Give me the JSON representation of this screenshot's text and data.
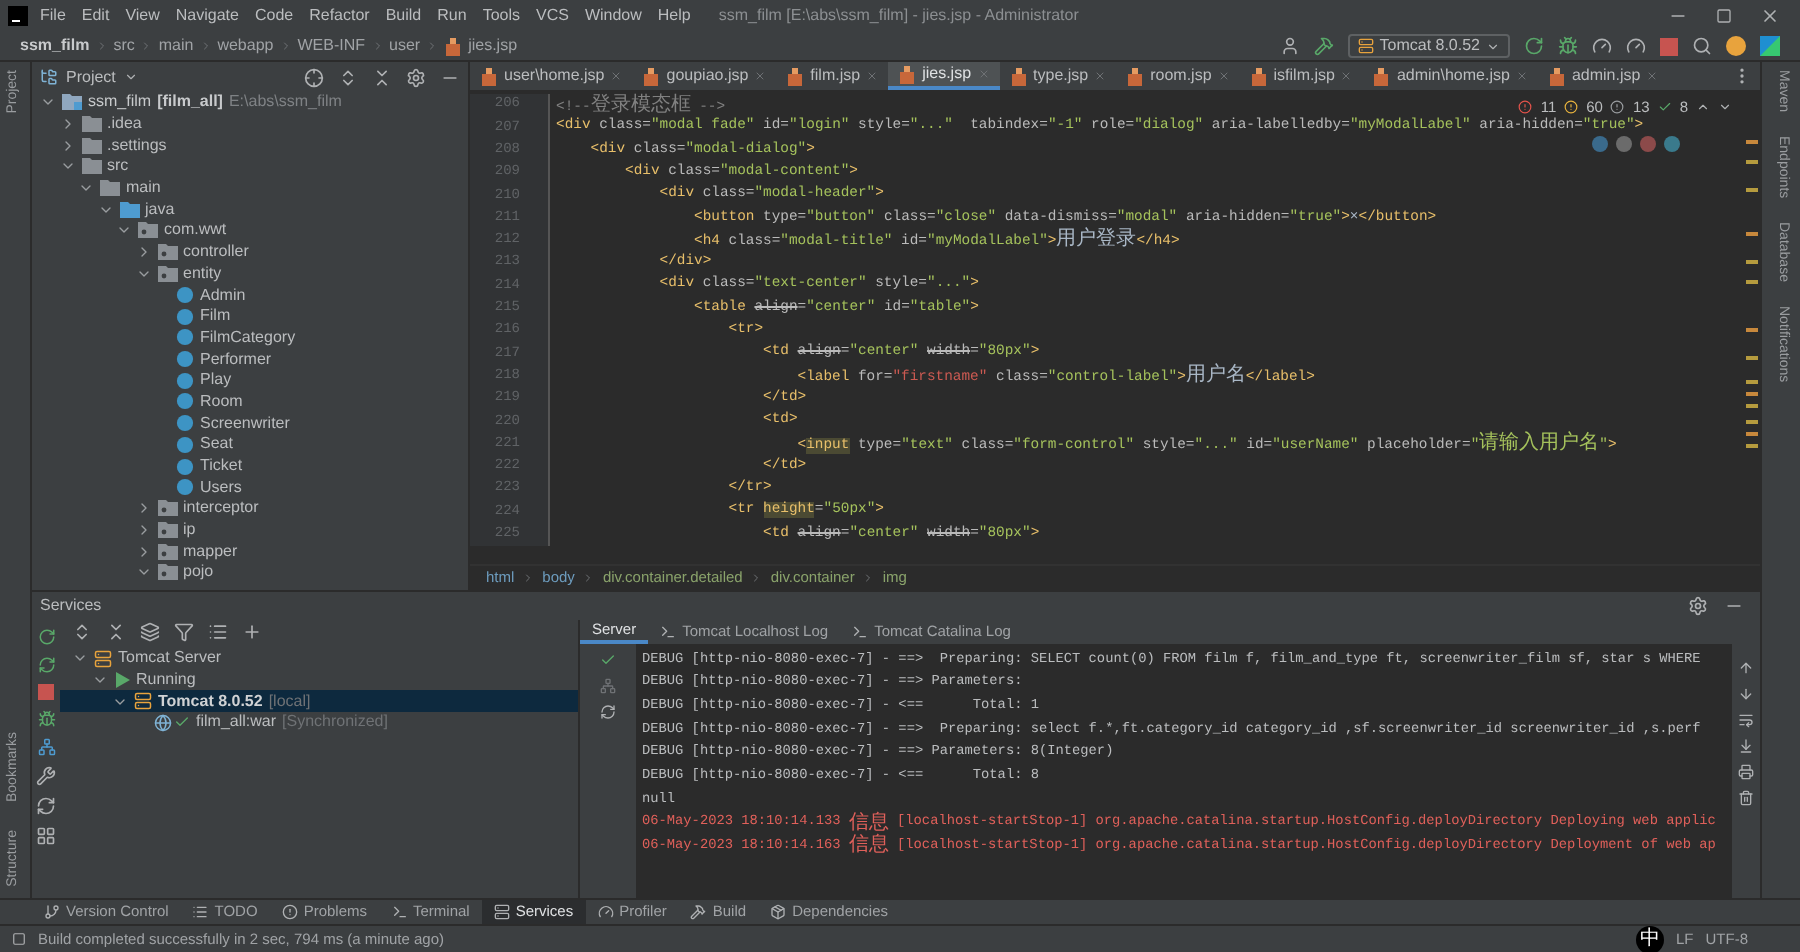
{
  "window": {
    "title": "ssm_film [E:\\abs\\ssm_film] - jies.jsp - Administrator"
  },
  "menu": [
    "File",
    "Edit",
    "View",
    "Navigate",
    "Code",
    "Refactor",
    "Build",
    "Run",
    "Tools",
    "VCS",
    "Window",
    "Help"
  ],
  "breadcrumb": [
    "ssm_film",
    "src",
    "main",
    "webapp",
    "WEB-INF",
    "user",
    "jies.jsp"
  ],
  "run_config": "Tomcat 8.0.52",
  "left_tool_tabs": [
    "Project",
    "Bookmarks",
    "Structure"
  ],
  "right_tool_tabs": [
    "Maven",
    "Endpoints",
    "Database",
    "Notifications"
  ],
  "project_panel": {
    "title": "Project",
    "tree": [
      {
        "name": "ssm_film",
        "module": "[film_all]",
        "path": "E:\\abs\\ssm_film",
        "kind": "module",
        "expanded": true,
        "children": [
          {
            "name": ".idea",
            "kind": "folder",
            "expanded": false
          },
          {
            "name": ".settings",
            "kind": "folder",
            "expanded": false
          },
          {
            "name": "src",
            "kind": "folder",
            "expanded": true,
            "children": [
              {
                "name": "main",
                "kind": "folder",
                "expanded": true,
                "children": [
                  {
                    "name": "java",
                    "kind": "source",
                    "expanded": true,
                    "children": [
                      {
                        "name": "com.wwt",
                        "kind": "package",
                        "expanded": true,
                        "children": [
                          {
                            "name": "controller",
                            "kind": "package",
                            "expanded": false
                          },
                          {
                            "name": "entity",
                            "kind": "package",
                            "expanded": true,
                            "children": [
                              {
                                "name": "Admin",
                                "kind": "class"
                              },
                              {
                                "name": "Film",
                                "kind": "class"
                              },
                              {
                                "name": "FilmCategory",
                                "kind": "class"
                              },
                              {
                                "name": "Performer",
                                "kind": "class"
                              },
                              {
                                "name": "Play",
                                "kind": "class"
                              },
                              {
                                "name": "Room",
                                "kind": "class"
                              },
                              {
                                "name": "Screenwriter",
                                "kind": "class"
                              },
                              {
                                "name": "Seat",
                                "kind": "class"
                              },
                              {
                                "name": "Ticket",
                                "kind": "class"
                              },
                              {
                                "name": "Users",
                                "kind": "class"
                              }
                            ]
                          },
                          {
                            "name": "interceptor",
                            "kind": "package",
                            "expanded": false
                          },
                          {
                            "name": "ip",
                            "kind": "package",
                            "expanded": false
                          },
                          {
                            "name": "mapper",
                            "kind": "package",
                            "expanded": false
                          },
                          {
                            "name": "pojo",
                            "kind": "package",
                            "expanded": true
                          }
                        ]
                      }
                    ]
                  }
                ]
              }
            ]
          }
        ]
      }
    ]
  },
  "editor_tabs": [
    {
      "label": "user\\home.jsp",
      "selected": false
    },
    {
      "label": "goupiao.jsp",
      "selected": false
    },
    {
      "label": "film.jsp",
      "selected": false
    },
    {
      "label": "jies.jsp",
      "selected": true
    },
    {
      "label": "type.jsp",
      "selected": false
    },
    {
      "label": "room.jsp",
      "selected": false
    },
    {
      "label": "isfilm.jsp",
      "selected": false
    },
    {
      "label": "admin\\home.jsp",
      "selected": false
    },
    {
      "label": "admin.jsp",
      "selected": false
    }
  ],
  "inspections": {
    "errors": "11",
    "warnings": "60",
    "weak_warnings": "13",
    "typos": "8"
  },
  "code": [
    {
      "number": "206",
      "tokens": [
        {
          "kind": "comment",
          "text": "<!--登录模态框 -->"
        }
      ]
    },
    {
      "number": "207",
      "tokens": [
        {
          "kind": "tag",
          "text": "<div"
        },
        {
          "kind": "attr",
          "text": " class="
        },
        {
          "kind": "value",
          "text": "\"modal fade\""
        },
        {
          "kind": "attr",
          "text": " id="
        },
        {
          "kind": "value",
          "text": "\"login\""
        },
        {
          "kind": "attr",
          "text": " style="
        },
        {
          "kind": "value",
          "text": "\"...\""
        },
        {
          "kind": "attr",
          "text": "  tabindex="
        },
        {
          "kind": "value",
          "text": "\"-1\""
        },
        {
          "kind": "attr",
          "text": " role="
        },
        {
          "kind": "value",
          "text": "\"dialog\""
        },
        {
          "kind": "attr",
          "text": " aria-labelledby="
        },
        {
          "kind": "value",
          "text": "\"myModalLabel\""
        },
        {
          "kind": "attr",
          "text": " aria-hidden="
        },
        {
          "kind": "value",
          "text": "\"true\""
        },
        {
          "kind": "tag",
          "text": ">"
        }
      ]
    },
    {
      "number": "208",
      "tokens": [
        {
          "kind": "tag",
          "text": "    <div"
        },
        {
          "kind": "attr",
          "text": " class="
        },
        {
          "kind": "value",
          "text": "\"modal-dialog\""
        },
        {
          "kind": "tag",
          "text": ">"
        }
      ]
    },
    {
      "number": "209",
      "tokens": [
        {
          "kind": "tag",
          "text": "        <div"
        },
        {
          "kind": "attr",
          "text": " class="
        },
        {
          "kind": "value",
          "text": "\"modal-content\""
        },
        {
          "kind": "tag",
          "text": ">"
        }
      ]
    },
    {
      "number": "210",
      "tokens": [
        {
          "kind": "tag",
          "text": "            <div"
        },
        {
          "kind": "attr",
          "text": " class="
        },
        {
          "kind": "value",
          "text": "\"modal-header\""
        },
        {
          "kind": "tag",
          "text": ">"
        }
      ]
    },
    {
      "number": "211",
      "tokens": [
        {
          "kind": "tag",
          "text": "                <button"
        },
        {
          "kind": "attr",
          "text": " type="
        },
        {
          "kind": "value",
          "text": "\"button\""
        },
        {
          "kind": "attr",
          "text": " class="
        },
        {
          "kind": "value",
          "text": "\"close\""
        },
        {
          "kind": "attr",
          "text": " data-dismiss="
        },
        {
          "kind": "value",
          "text": "\"modal\""
        },
        {
          "kind": "attr",
          "text": " aria-hidden="
        },
        {
          "kind": "value",
          "text": "\"true\""
        },
        {
          "kind": "tag",
          "text": ">"
        },
        {
          "kind": "text",
          "text": "×"
        },
        {
          "kind": "tag",
          "text": "</button>"
        }
      ]
    },
    {
      "number": "212",
      "tokens": [
        {
          "kind": "tag",
          "text": "                <h4"
        },
        {
          "kind": "attr",
          "text": " class="
        },
        {
          "kind": "value",
          "text": "\"modal-title\""
        },
        {
          "kind": "attr",
          "text": " id="
        },
        {
          "kind": "value",
          "text": "\"myModalLabel\""
        },
        {
          "kind": "tag",
          "text": ">"
        },
        {
          "kind": "text",
          "text": "用户登录"
        },
        {
          "kind": "tag",
          "text": "</h4>"
        }
      ]
    },
    {
      "number": "213",
      "tokens": [
        {
          "kind": "tag",
          "text": "            </div>"
        }
      ]
    },
    {
      "number": "214",
      "tokens": [
        {
          "kind": "tag",
          "text": "            <div"
        },
        {
          "kind": "attr",
          "text": " class="
        },
        {
          "kind": "value",
          "text": "\"text-center\""
        },
        {
          "kind": "attr",
          "text": " style="
        },
        {
          "kind": "value",
          "text": "\"...\""
        },
        {
          "kind": "tag",
          "text": ">"
        }
      ]
    },
    {
      "number": "215",
      "tokens": [
        {
          "kind": "tag",
          "text": "                <table "
        },
        {
          "kind": "deprecated",
          "text": "align"
        },
        {
          "kind": "attr",
          "text": "="
        },
        {
          "kind": "value",
          "text": "\"center\""
        },
        {
          "kind": "attr",
          "text": " id="
        },
        {
          "kind": "value",
          "text": "\"table\""
        },
        {
          "kind": "tag",
          "text": ">"
        }
      ]
    },
    {
      "number": "216",
      "tokens": [
        {
          "kind": "tag",
          "text": "                    <tr>"
        }
      ]
    },
    {
      "number": "217",
      "tokens": [
        {
          "kind": "tag",
          "text": "                        <td "
        },
        {
          "kind": "deprecated",
          "text": "align"
        },
        {
          "kind": "attr",
          "text": "="
        },
        {
          "kind": "value",
          "text": "\"center\" "
        },
        {
          "kind": "deprecated",
          "text": "width"
        },
        {
          "kind": "attr",
          "text": "="
        },
        {
          "kind": "value",
          "text": "\"80px\""
        },
        {
          "kind": "tag",
          "text": ">"
        }
      ]
    },
    {
      "number": "218",
      "tokens": [
        {
          "kind": "tag",
          "text": "                            <label"
        },
        {
          "kind": "attr",
          "text": " for="
        },
        {
          "kind": "unresolved",
          "text": "\"firstname\""
        },
        {
          "kind": "attr",
          "text": " class="
        },
        {
          "kind": "value",
          "text": "\"control-label\""
        },
        {
          "kind": "tag",
          "text": ">"
        },
        {
          "kind": "text",
          "text": "用户名"
        },
        {
          "kind": "tag",
          "text": "</label>"
        }
      ]
    },
    {
      "number": "219",
      "tokens": [
        {
          "kind": "tag",
          "text": "                        </td>"
        }
      ]
    },
    {
      "number": "220",
      "tokens": [
        {
          "kind": "tag",
          "text": "                        <td>"
        }
      ]
    },
    {
      "number": "221",
      "tokens": [
        {
          "kind": "tag",
          "text": "                            <"
        },
        {
          "kind": "usage",
          "text": "input"
        },
        {
          "kind": "attr",
          "text": " type="
        },
        {
          "kind": "value",
          "text": "\"text\""
        },
        {
          "kind": "attr",
          "text": " class="
        },
        {
          "kind": "value",
          "text": "\"form-control\""
        },
        {
          "kind": "attr",
          "text": " style="
        },
        {
          "kind": "value",
          "text": "\"...\""
        },
        {
          "kind": "attr",
          "text": " id="
        },
        {
          "kind": "value",
          "text": "\"userName\""
        },
        {
          "kind": "attr",
          "text": " placeholder="
        },
        {
          "kind": "value",
          "text": "\"请输入用户名\""
        },
        {
          "kind": "tag",
          "text": ">"
        }
      ]
    },
    {
      "number": "222",
      "tokens": [
        {
          "kind": "tag",
          "text": "                        </td>"
        }
      ]
    },
    {
      "number": "223",
      "tokens": [
        {
          "kind": "tag",
          "text": "                    </tr>"
        }
      ]
    },
    {
      "number": "224",
      "tokens": [
        {
          "kind": "tag",
          "text": "                    <tr "
        },
        {
          "kind": "usage",
          "text": "height"
        },
        {
          "kind": "attr",
          "text": "="
        },
        {
          "kind": "value",
          "text": "\"50px\""
        },
        {
          "kind": "tag",
          "text": ">"
        }
      ]
    },
    {
      "number": "225",
      "tokens": [
        {
          "kind": "tag",
          "text": "                        <td "
        },
        {
          "kind": "deprecated",
          "text": "align"
        },
        {
          "kind": "attr",
          "text": "="
        },
        {
          "kind": "value",
          "text": "\"center\" "
        },
        {
          "kind": "deprecated",
          "text": "width"
        },
        {
          "kind": "attr",
          "text": "="
        },
        {
          "kind": "value",
          "text": "\"80px\""
        },
        {
          "kind": "tag",
          "text": ">"
        }
      ]
    }
  ],
  "editor_breadcrumb": [
    "html",
    "body",
    "div.container.detailed",
    "div.container",
    "img"
  ],
  "services": {
    "title": "Services",
    "tree": [
      {
        "name": "Tomcat Server",
        "kind": "server",
        "selected": false,
        "expanded": true,
        "children": [
          {
            "name": "Running",
            "kind": "status",
            "selected": false,
            "expanded": true,
            "children": [
              {
                "name": "Tomcat 8.0.52",
                "suffix": "[local]",
                "kind": "instance",
                "selected": true,
                "expanded": true,
                "children": [
                  {
                    "name": "film_all:war",
                    "suffix": "[Synchronized]",
                    "kind": "artifact",
                    "selected": false
                  }
                ]
              }
            ]
          }
        ]
      }
    ],
    "console_tabs": [
      {
        "label": "Server",
        "selected": true
      },
      {
        "label": "Tomcat Localhost Log",
        "selected": false
      },
      {
        "label": "Tomcat Catalina Log",
        "selected": false
      }
    ],
    "console": [
      {
        "kind": "debug",
        "text": "DEBUG [http-nio-8080-exec-7] - ==>  Preparing: SELECT count(0) FROM film f, film_and_type ft, screenwriter_film sf, star s WHERE"
      },
      {
        "kind": "debug",
        "text": "DEBUG [http-nio-8080-exec-7] - ==> Parameters: "
      },
      {
        "kind": "debug",
        "text": "DEBUG [http-nio-8080-exec-7] - <==      Total: 1"
      },
      {
        "kind": "debug",
        "text": "DEBUG [http-nio-8080-exec-7] - ==>  Preparing: select f.*,ft.category_id category_id ,sf.screenwriter_id screenwriter_id ,s.perf"
      },
      {
        "kind": "debug",
        "text": "DEBUG [http-nio-8080-exec-7] - ==> Parameters: 8(Integer)"
      },
      {
        "kind": "debug",
        "text": "DEBUG [http-nio-8080-exec-7] - <==      Total: 8"
      },
      {
        "kind": "debug",
        "text": "null"
      },
      {
        "kind": "error",
        "text": "06-May-2023 18:10:14.133 信息 [localhost-startStop-1] org.apache.catalina.startup.HostConfig.deployDirectory Deploying web applic"
      },
      {
        "kind": "error",
        "text": "06-May-2023 18:10:14.163 信息 [localhost-startStop-1] org.apache.catalina.startup.HostConfig.deployDirectory Deployment of web ap"
      }
    ]
  },
  "tool_windows": [
    {
      "label": "Version Control",
      "selected": false
    },
    {
      "label": "TODO",
      "selected": false
    },
    {
      "label": "Problems",
      "selected": false
    },
    {
      "label": "Terminal",
      "selected": false
    },
    {
      "label": "Services",
      "selected": true
    },
    {
      "label": "Profiler",
      "selected": false
    },
    {
      "label": "Build",
      "selected": false
    },
    {
      "label": "Dependencies",
      "selected": false
    }
  ],
  "status_bar": {
    "message": "Build completed successfully in 2 sec, 794 ms (a minute ago)",
    "line_separator": "LF",
    "encoding": "UTF-8",
    "ime": "中"
  }
}
